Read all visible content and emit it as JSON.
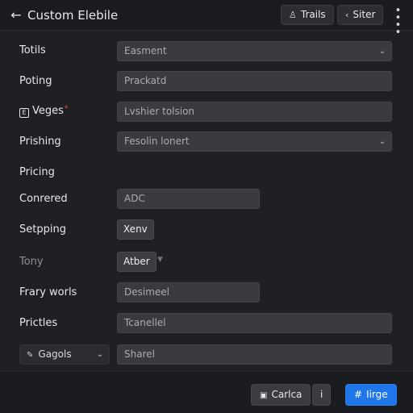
{
  "header": {
    "back_icon": "arrow-left-icon",
    "title": "Custom Elebile",
    "traits_label": "Trails",
    "traits_icon": "user-icon",
    "siter_label": "Siter",
    "siter_icon": "chevron-left-icon",
    "more_icon": "grid-dots-icon"
  },
  "rows": [
    {
      "label": "Totils",
      "value": "Easment",
      "kind": "select"
    },
    {
      "label": "Poting",
      "value": "Prackatd",
      "kind": "input"
    },
    {
      "label": "Veges",
      "value": "Lvshier tolsion",
      "kind": "input",
      "badge": "E",
      "required": "*"
    },
    {
      "label": "Prishing",
      "value": "Fesolin lonert",
      "kind": "select"
    },
    {
      "label": "Pricing",
      "value": "",
      "kind": "label"
    },
    {
      "label": "Conrered",
      "value": "ADC",
      "kind": "input"
    },
    {
      "label": "Setpping",
      "value": "Xenv",
      "kind": "chip"
    },
    {
      "label": "Tony",
      "value": "Atber",
      "kind": "chip-dropdown"
    },
    {
      "label": "Frary worls",
      "value": "Desimeel",
      "kind": "input"
    },
    {
      "label": "Prictles",
      "value": "Tcanellel",
      "kind": "input"
    },
    {
      "label": "Gagols",
      "value": "Sharel",
      "kind": "select-labeled"
    }
  ],
  "footer": {
    "cancel_label": "Carlca",
    "cancel_icon": "clipboard-icon",
    "info_label": "i",
    "save_label": "Iirge",
    "save_icon": "hash-icon"
  },
  "colors": {
    "accent": "#1f76e8",
    "background": "#1f2024",
    "field": "#3a3b40",
    "required": "#e0524d"
  }
}
